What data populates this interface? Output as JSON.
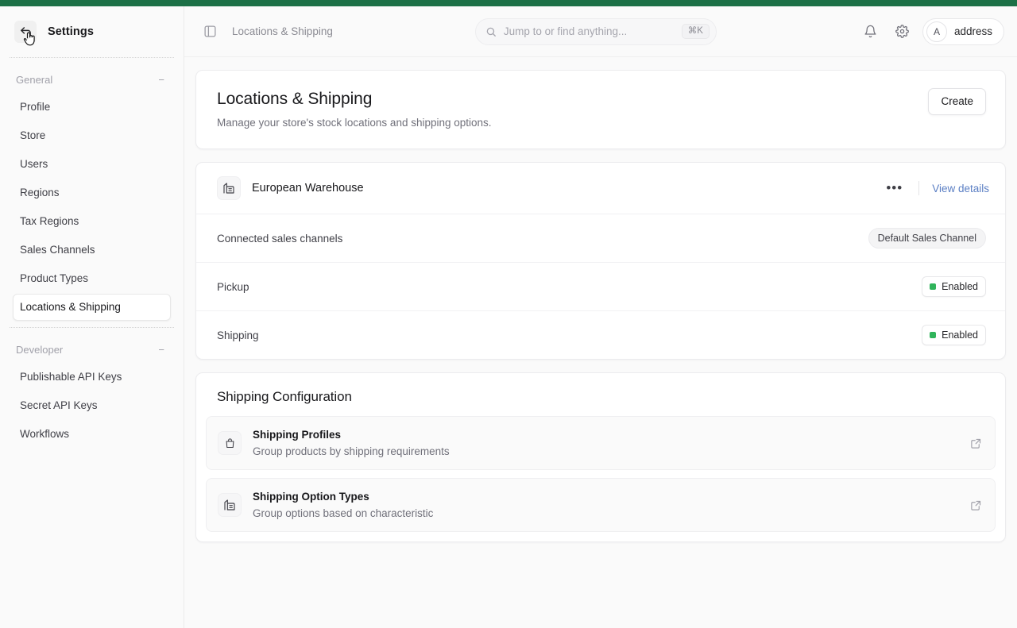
{
  "theme": {
    "accent_bar": "#1c7046",
    "link_blue": "#5b7fc4",
    "status_green": "#30b45b",
    "page_bg": "#fafafa",
    "card_bg": "#ffffff"
  },
  "sidebar": {
    "title": "Settings",
    "back_icon": "back-arrow-icon",
    "cursor": "hand-pointer-cursor",
    "sections": [
      {
        "label": "General",
        "collapse": "−",
        "items": [
          {
            "label": "Profile",
            "active": false
          },
          {
            "label": "Store",
            "active": false
          },
          {
            "label": "Users",
            "active": false
          },
          {
            "label": "Regions",
            "active": false
          },
          {
            "label": "Tax Regions",
            "active": false
          },
          {
            "label": "Sales Channels",
            "active": false
          },
          {
            "label": "Product Types",
            "active": false
          },
          {
            "label": "Locations & Shipping",
            "active": true
          }
        ]
      },
      {
        "label": "Developer",
        "collapse": "−",
        "items": [
          {
            "label": "Publishable API Keys",
            "active": false
          },
          {
            "label": "Secret API Keys",
            "active": false
          },
          {
            "label": "Workflows",
            "active": false
          }
        ]
      }
    ]
  },
  "topbar": {
    "panel_toggle_icon": "sidebar-panel-icon",
    "breadcrumb": "Locations & Shipping",
    "search": {
      "icon": "search-icon",
      "placeholder": "Jump to or find anything...",
      "shortcut": "⌘K"
    },
    "notifications_icon": "bell-icon",
    "settings_icon": "gear-icon",
    "account": {
      "initial": "A",
      "name": "address"
    }
  },
  "hero": {
    "title": "Locations & Shipping",
    "subtitle": "Manage your store's stock locations and shipping options.",
    "create_label": "Create"
  },
  "location": {
    "icon": "warehouse-icon",
    "name": "European Warehouse",
    "menu_icon": "ellipsis-icon",
    "view_details_label": "View details",
    "rows": [
      {
        "label": "Connected sales channels",
        "value_type": "pill",
        "value": "Default Sales Channel"
      },
      {
        "label": "Pickup",
        "value_type": "badge",
        "value": "Enabled"
      },
      {
        "label": "Shipping",
        "value_type": "badge",
        "value": "Enabled"
      }
    ]
  },
  "shipping_config": {
    "title": "Shipping Configuration",
    "items": [
      {
        "icon": "bag-icon",
        "title": "Shipping Profiles",
        "desc": "Group products by shipping requirements",
        "action_icon": "external-link-icon"
      },
      {
        "icon": "warehouse-icon",
        "title": "Shipping Option Types",
        "desc": "Group options based on characteristic",
        "action_icon": "external-link-icon"
      }
    ]
  }
}
